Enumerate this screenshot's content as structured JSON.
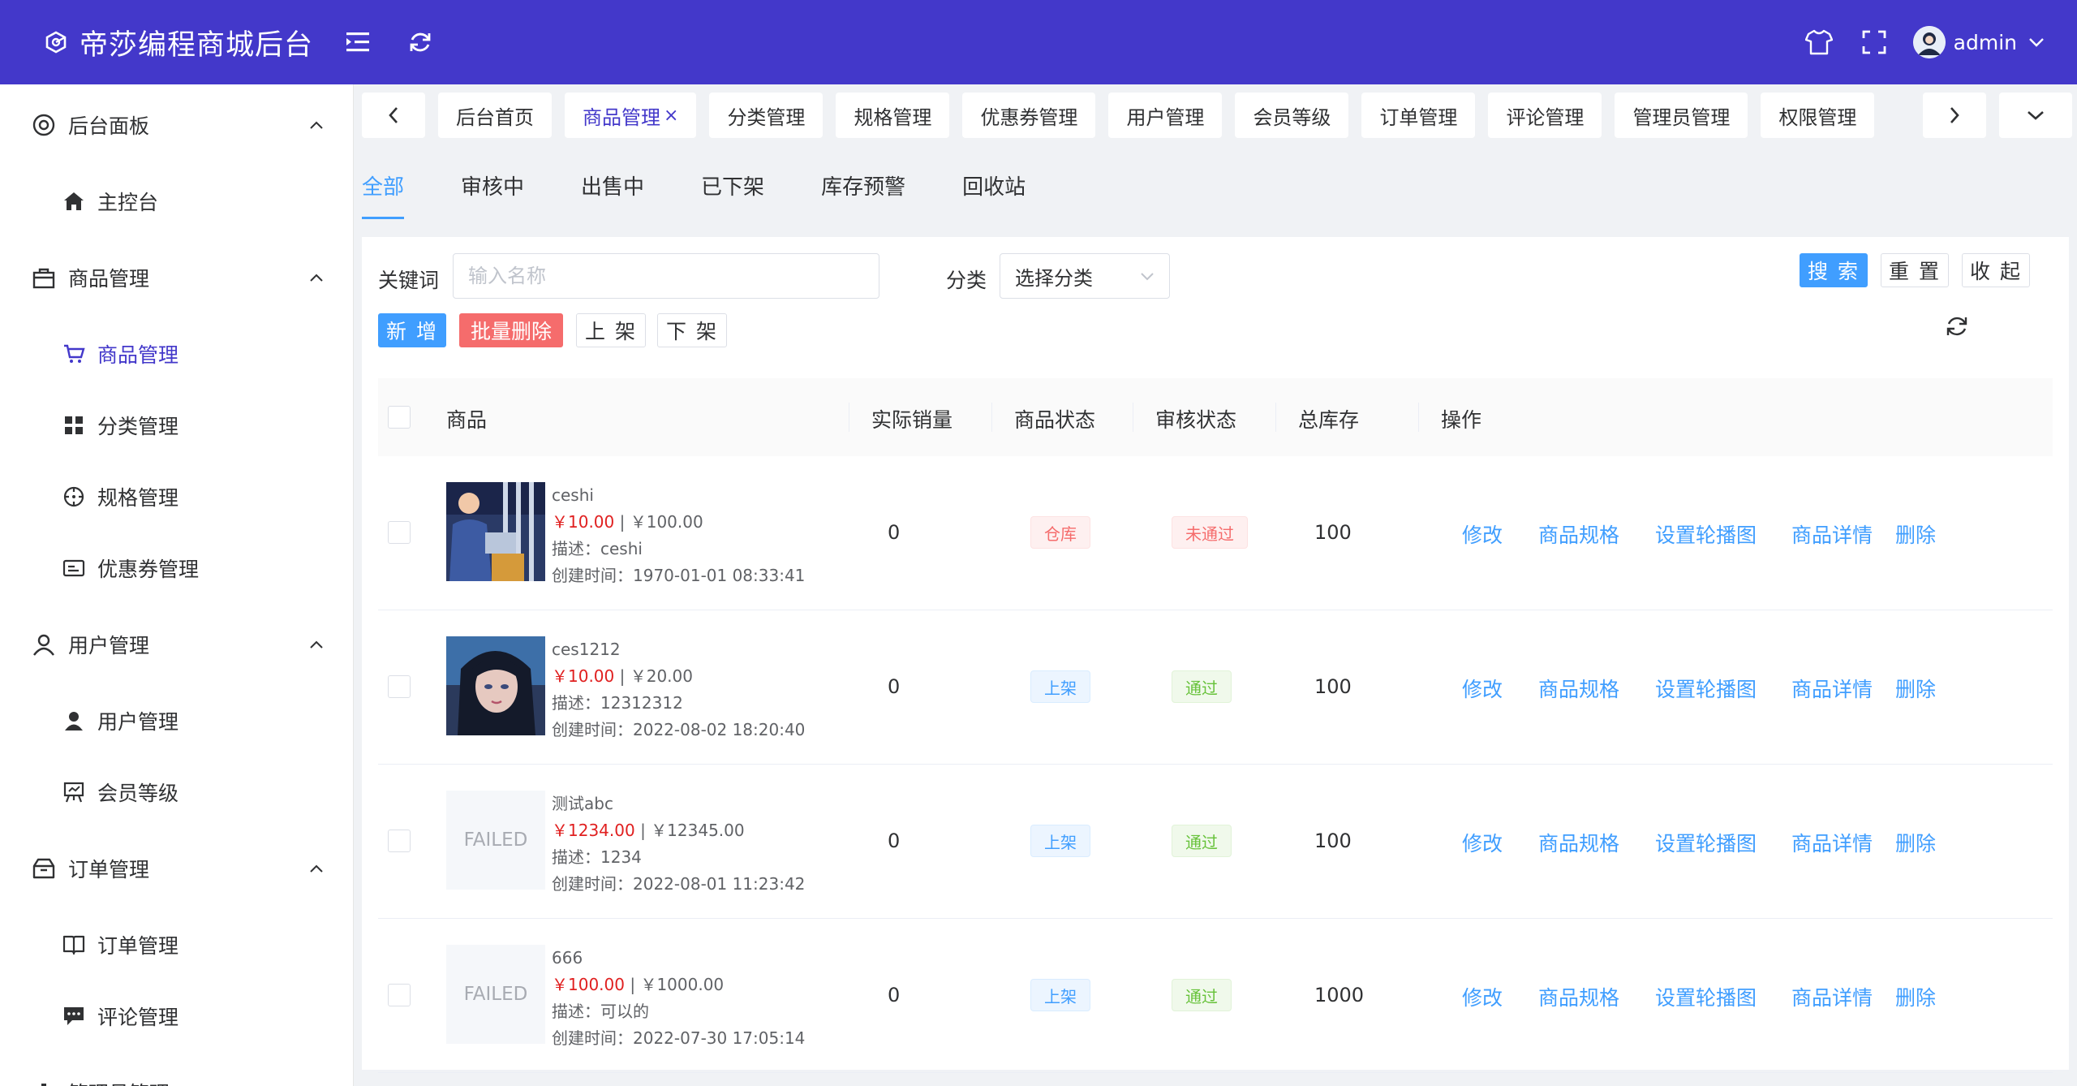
{
  "header": {
    "title": "帝莎编程商城后台",
    "username": "admin",
    "brand_color": "#4338ca"
  },
  "sidebar": {
    "groups": [
      {
        "label": "后台面板",
        "icon": "dashboard-icon",
        "items": [
          {
            "label": "主控台",
            "icon": "home-icon"
          }
        ]
      },
      {
        "label": "商品管理",
        "icon": "bag-icon",
        "items": [
          {
            "label": "商品管理",
            "icon": "cart-icon",
            "active": true
          },
          {
            "label": "分类管理",
            "icon": "grid-icon"
          },
          {
            "label": "规格管理",
            "icon": "compass-icon"
          },
          {
            "label": "优惠券管理",
            "icon": "coupon-icon"
          }
        ]
      },
      {
        "label": "用户管理",
        "icon": "user-outline-icon",
        "items": [
          {
            "label": "用户管理",
            "icon": "user-icon"
          },
          {
            "label": "会员等级",
            "icon": "easel-icon"
          }
        ]
      },
      {
        "label": "订单管理",
        "icon": "box-icon",
        "items": [
          {
            "label": "订单管理",
            "icon": "book-icon"
          },
          {
            "label": "评论管理",
            "icon": "comment-icon"
          }
        ]
      },
      {
        "label": "管理员管理",
        "icon": "chart-icon",
        "items": []
      }
    ]
  },
  "tabs": [
    {
      "label": "后台首页"
    },
    {
      "label": "商品管理",
      "active": true,
      "close": "×"
    },
    {
      "label": "分类管理"
    },
    {
      "label": "规格管理"
    },
    {
      "label": "优惠券管理"
    },
    {
      "label": "用户管理"
    },
    {
      "label": "会员等级"
    },
    {
      "label": "订单管理"
    },
    {
      "label": "评论管理"
    },
    {
      "label": "管理员管理"
    },
    {
      "label": "权限管理"
    }
  ],
  "status_tabs": [
    "全部",
    "审核中",
    "出售中",
    "已下架",
    "库存预警",
    "回收站"
  ],
  "filter": {
    "keyword_label": "关键词",
    "keyword_placeholder": "输入名称",
    "category_label": "分类",
    "category_value": "选择分类",
    "search": "搜 索",
    "reset": "重 置",
    "collapse": "收 起"
  },
  "actions": {
    "add": "新 增",
    "batch_delete": "批量删除",
    "on_shelf": "上 架",
    "off_shelf": "下 架"
  },
  "table": {
    "headers": [
      "商品",
      "实际销量",
      "商品状态",
      "审核状态",
      "总库存",
      "操作"
    ],
    "operations": [
      "修改",
      "商品规格",
      "设置轮播图",
      "商品详情",
      "删除"
    ],
    "rows": [
      {
        "name": "ceshi",
        "price": "￥10.00",
        "oprice": "￥100.00",
        "desc": "描述：ceshi",
        "created": "创建时间：1970-01-01 08:33:41",
        "sales": "0",
        "status": "仓库",
        "status_kind": "warehouse",
        "audit": "未通过",
        "audit_kind": "fail",
        "stock": "100",
        "image": "photo-office"
      },
      {
        "name": "ces1212",
        "price": "￥10.00",
        "oprice": "￥20.00",
        "desc": "描述：12312312",
        "created": "创建时间：2022-08-02 18:20:40",
        "sales": "0",
        "status": "上架",
        "status_kind": "online",
        "audit": "通过",
        "audit_kind": "pass",
        "stock": "100",
        "image": "photo-portrait"
      },
      {
        "name": "测试abc",
        "price": "￥1234.00",
        "oprice": "￥12345.00",
        "desc": "描述：1234",
        "created": "创建时间：2022-08-01 11:23:42",
        "sales": "0",
        "status": "上架",
        "status_kind": "online",
        "audit": "通过",
        "audit_kind": "pass",
        "stock": "100",
        "image": "failed",
        "image_text": "FAILED"
      },
      {
        "name": "666",
        "price": "￥100.00",
        "oprice": "￥1000.00",
        "desc": "描述：可以的",
        "created": "创建时间：2022-07-30 17:05:14",
        "sales": "0",
        "status": "上架",
        "status_kind": "online",
        "audit": "通过",
        "audit_kind": "pass",
        "stock": "1000",
        "image": "failed",
        "image_text": "FAILED"
      }
    ]
  }
}
